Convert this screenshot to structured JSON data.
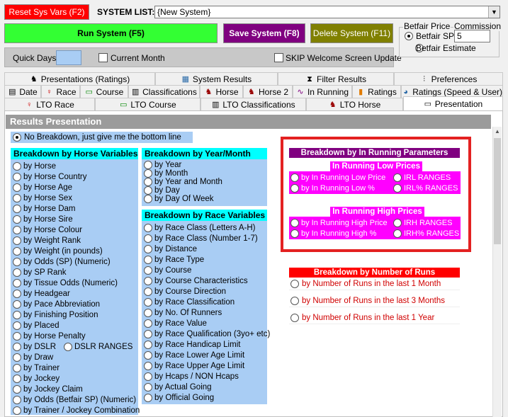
{
  "top": {
    "reset_label": "Reset Sys Vars (F2)",
    "system_list_label": "SYSTEM LIST:",
    "system_list_value": "{New System}",
    "run_label": "Run System (F5)",
    "save_label": "Save System (F8)",
    "delete_label": "Delete System (F11)",
    "quick_days_label": "Quick Days",
    "quick_days_value": "",
    "current_month_label": "Current Month",
    "skip_label": "SKIP Welcome Screen Update",
    "betfair_price_label": "Betfair Price",
    "commission_label": "Commission",
    "betfair_sp_label": "Betfair SP",
    "commission_value": "5",
    "betfair_estimate_label": "Betfair Estimate"
  },
  "tabs_row1": [
    "Presentations (Ratings)",
    "System Results",
    "Filter Results",
    "Preferences"
  ],
  "tabs_row2": [
    "Date",
    "Race",
    "Course",
    "Classifications",
    "Horse",
    "Horse 2",
    "In Running",
    "Ratings",
    "Ratings (Speed & User)"
  ],
  "tabs_row3": [
    "LTO Race",
    "LTO Course",
    "LTO Classifications",
    "LTO Horse",
    "Presentation"
  ],
  "results": {
    "title": "Results Presentation",
    "no_breakdown": "No Breakdown, just give me the bottom line"
  },
  "horse_vars": {
    "title": "Breakdown by Horse Variables",
    "items": [
      "by Horse",
      "by Horse Country",
      "by Horse Age",
      "by Horse Sex",
      "by Horse Dam",
      "by Horse Sire",
      "by Horse Colour",
      "by Weight Rank",
      "by Weight (in pounds)",
      "by Odds (SP) (Numeric)",
      "by SP Rank",
      "by Tissue Odds (Numeric)",
      "by Headgear",
      "by Pace Abbreviation",
      "by Finishing Position",
      "by Placed",
      "by Horse Penalty",
      "by DSLR",
      "by Draw",
      "by Trainer",
      "by Jockey",
      "by Jockey Claim",
      "by Odds (Betfair SP) (Numeric)",
      "by Trainer / Jockey Combination"
    ],
    "dslr_ranges": "DSLR RANGES"
  },
  "year_month": {
    "title": "Breakdown by Year/Month",
    "items": [
      "by Year",
      "by Month",
      "by Year and Month",
      "by Day",
      "by Day Of Week"
    ]
  },
  "race_vars": {
    "title": "Breakdown by Race Variables",
    "items": [
      "by Race Class (Letters A-H)",
      "by Race Class (Number 1-7)",
      "by Distance",
      "by Race Type",
      "by Course",
      "by Course Characteristics",
      "by Course Direction",
      "by Race Classification",
      "by No. Of Runners",
      "by Race Value",
      "by Race Qualification (3yo+ etc)",
      "by Race Handicap Limit",
      "by Race Lower Age Limit",
      "by Race Upper Age Limit",
      "by Hcaps / NON Hcaps",
      "by Actual Going",
      "by Official Going"
    ]
  },
  "in_running": {
    "title": "Breakdown by In Running Parameters",
    "low_title": "In Running Low Prices",
    "low_items": [
      "by In Running Low Price",
      "IRL RANGES",
      "by In Running Low %",
      "IRL% RANGES"
    ],
    "high_title": "In Running High Prices",
    "high_items": [
      "by In Running High Price",
      "IRH RANGES",
      "by In Running High %",
      "IRH% RANGES"
    ]
  },
  "runs": {
    "title": "Breakdown by Number of Runs",
    "items": [
      "by Number of Runs in the last 1 Month",
      "by Number of Runs in the last 3 Months",
      "by Number of Runs in the last 1 Year"
    ]
  },
  "colors": {
    "red": "#ff0000",
    "green": "#33ff33",
    "purple": "#800080",
    "olive": "#808000",
    "cyan": "#00ffff",
    "magenta": "#ff00ff",
    "dark_magenta": "#800080",
    "panel_blue": "#a9cdf4",
    "highlight_red": "#e32121"
  }
}
